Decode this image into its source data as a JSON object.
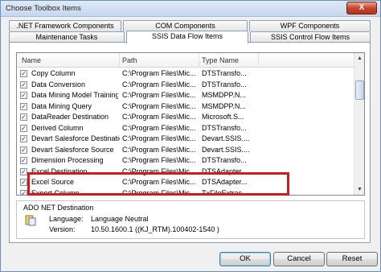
{
  "window": {
    "title": "Choose Toolbox Items",
    "close_label": "X"
  },
  "tabs_row1": [
    {
      "label": ".NET Framework Components"
    },
    {
      "label": "COM Components"
    },
    {
      "label": "WPF Components"
    }
  ],
  "tabs_row2": [
    {
      "label": "Maintenance Tasks"
    },
    {
      "label": "SSIS Data Flow Items",
      "active": true
    },
    {
      "label": "SSIS Control Flow Items"
    }
  ],
  "grid": {
    "columns": [
      "Name",
      "Path",
      "Type Name"
    ],
    "rows": [
      {
        "checked": true,
        "name": "Copy Column",
        "path": "C:\\Program Files\\Mic...",
        "type": "DTSTransfo..."
      },
      {
        "checked": true,
        "name": "Data Conversion",
        "path": "C:\\Program Files\\Mic...",
        "type": "DTSTransfo..."
      },
      {
        "checked": true,
        "name": "Data Mining Model Training",
        "path": "C:\\Program Files\\Mic...",
        "type": "MSMDPP.N..."
      },
      {
        "checked": true,
        "name": "Data Mining Query",
        "path": "C:\\Program Files\\Mic...",
        "type": "MSMDPP.N..."
      },
      {
        "checked": true,
        "name": "DataReader Destination",
        "path": "C:\\Program Files\\Mic...",
        "type": "Microsoft.S..."
      },
      {
        "checked": true,
        "name": "Derived Column",
        "path": "C:\\Program Files\\Mic...",
        "type": "DTSTransfo..."
      },
      {
        "checked": true,
        "name": "Devart Salesforce Destination",
        "path": "C:\\Program Files\\Mic...",
        "type": "Devart.SSIS...."
      },
      {
        "checked": true,
        "name": "Devart Salesforce Source",
        "path": "C:\\Program Files\\Mic...",
        "type": "Devart.SSIS...."
      },
      {
        "checked": true,
        "name": "Dimension Processing",
        "path": "C:\\Program Files\\Mic...",
        "type": "DTSTransfo..."
      },
      {
        "checked": true,
        "name": "Excel Destination",
        "path": "C:\\Program Files\\Mic...",
        "type": "DTSAdapter..."
      },
      {
        "checked": true,
        "name": "Excel Source",
        "path": "C:\\Program Files\\Mic...",
        "type": "DTSAdapter..."
      },
      {
        "checked": true,
        "name": "Export Column",
        "path": "C:\\Program Files\\Mic...",
        "type": "TxFileExtrac..."
      }
    ]
  },
  "info": {
    "item_name": "ADO NET Destination",
    "language_label": "Language:",
    "language_value": "Language Neutral",
    "version_label": "Version:",
    "version_value": "10.50.1600.1 ((KJ_RTM).100402-1540 )"
  },
  "buttons": {
    "ok": "OK",
    "cancel": "Cancel",
    "reset": "Reset"
  },
  "colors": {
    "highlight": "#d7191c",
    "check": "#1c3d9a"
  }
}
